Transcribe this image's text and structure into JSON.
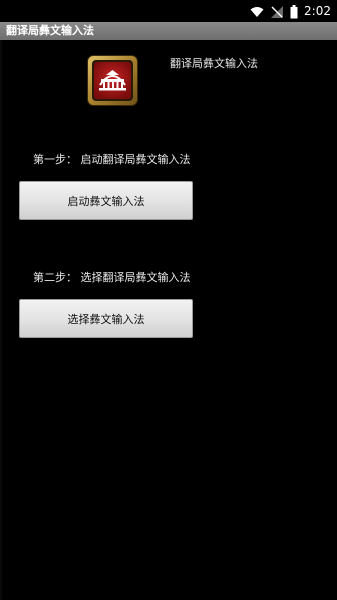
{
  "status_bar": {
    "time": "2:02",
    "icons": [
      "wifi-icon",
      "signal-icon",
      "battery-icon"
    ]
  },
  "title_bar": {
    "title": "翻译局彝文输入法"
  },
  "app": {
    "logo_icon": "bridge-logo-icon",
    "label": "翻译局彝文输入法"
  },
  "steps": [
    {
      "label": "第一步： 启动翻译局彝文输入法",
      "button": "启动彝文输入法"
    },
    {
      "label": "第二步： 选择翻译局彝文输入法",
      "button": "选择彝文输入法"
    }
  ],
  "colors": {
    "background": "#000000",
    "title_bar": "#7a7a7a",
    "logo_red": "#b01a1a",
    "logo_gold": "#c9a44a"
  }
}
